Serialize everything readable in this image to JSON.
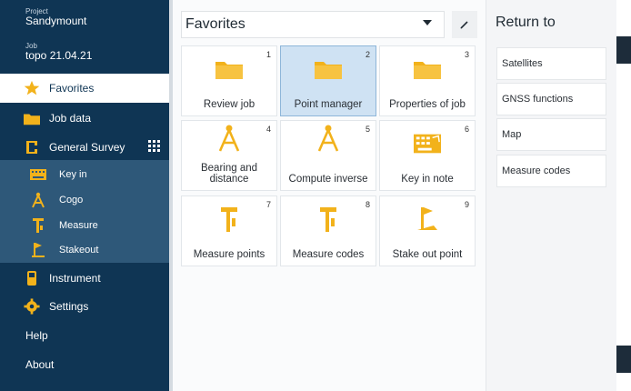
{
  "project": {
    "label": "Project",
    "name": "Sandymount"
  },
  "job": {
    "label": "Job",
    "name": "topo 21.04.21"
  },
  "nav": {
    "favorites": "Favorites",
    "job_data": "Job data",
    "general_survey": "General Survey",
    "sub": [
      "Key in",
      "Cogo",
      "Measure",
      "Stakeout"
    ],
    "instrument": "Instrument",
    "settings": "Settings",
    "help": "Help",
    "about": "About"
  },
  "combo": {
    "value": "Favorites"
  },
  "tiles": [
    {
      "num": "1",
      "label": "Review job",
      "icon": "folder-icon"
    },
    {
      "num": "2",
      "label": "Point manager",
      "icon": "folder-icon"
    },
    {
      "num": "3",
      "label": "Properties of job",
      "icon": "folder-icon"
    },
    {
      "num": "4",
      "label": "Bearing and distance",
      "icon": "compass-icon"
    },
    {
      "num": "5",
      "label": "Compute inverse",
      "icon": "compass-icon"
    },
    {
      "num": "6",
      "label": "Key in note",
      "icon": "keyboard-icon"
    },
    {
      "num": "7",
      "label": "Measure points",
      "icon": "survey-pole-icon"
    },
    {
      "num": "8",
      "label": "Measure codes",
      "icon": "survey-pole-icon"
    },
    {
      "num": "9",
      "label": "Stake out point",
      "icon": "stakeout-flag-icon"
    }
  ],
  "right": {
    "title": "Return to",
    "items": [
      "Satellites",
      "GNSS functions",
      "Map",
      "Measure codes"
    ]
  },
  "colors": {
    "nav": "#0f3554",
    "accent": "#f2b21b",
    "selected_tile": "#cfe2f3"
  }
}
